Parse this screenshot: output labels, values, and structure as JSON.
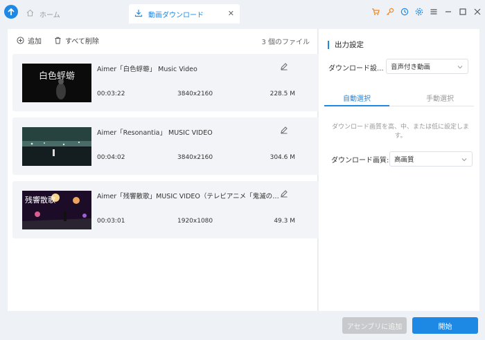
{
  "titlebar": {
    "tabs": [
      {
        "label": "ホーム",
        "icon": "home-icon"
      },
      {
        "label": "動画ダウンロード",
        "icon": "download-icon"
      }
    ],
    "accent": "#1e88e5",
    "icon_accent": "#f08a24"
  },
  "toolbar": {
    "add_label": "追加",
    "delete_all_label": "すべて削除",
    "file_count": "3 個のファイル"
  },
  "videos": [
    {
      "title": "Aimer「白色蜉蝣」 Music Video",
      "duration": "00:03:22",
      "resolution": "3840x2160",
      "size": "228.5 M",
      "thumb_text": "白色蜉蝣"
    },
    {
      "title": "Aimer「Resonantia」 MUSIC VIDEO",
      "duration": "00:04:02",
      "resolution": "3840x2160",
      "size": "304.6 M"
    },
    {
      "title": "Aimer「残響散歌」MUSIC VIDEO（テレビアニメ「鬼滅の刃...",
      "duration": "00:03:01",
      "resolution": "1920x1080",
      "size": "49.3 M",
      "thumb_text": "残響散歌"
    }
  ],
  "output": {
    "title": "出力設定",
    "download_setting_label": "ダウンロード設...",
    "download_setting_value": "音声付き動画",
    "tabs": [
      "自動選択",
      "手動選択"
    ],
    "hint": "ダウンロード画質を高、中、または低に設定します。",
    "quality_label": "ダウンロード画質:",
    "quality_value": "高画質"
  },
  "footer": {
    "assemble_label": "アセンブリに追加",
    "start_label": "開始"
  }
}
